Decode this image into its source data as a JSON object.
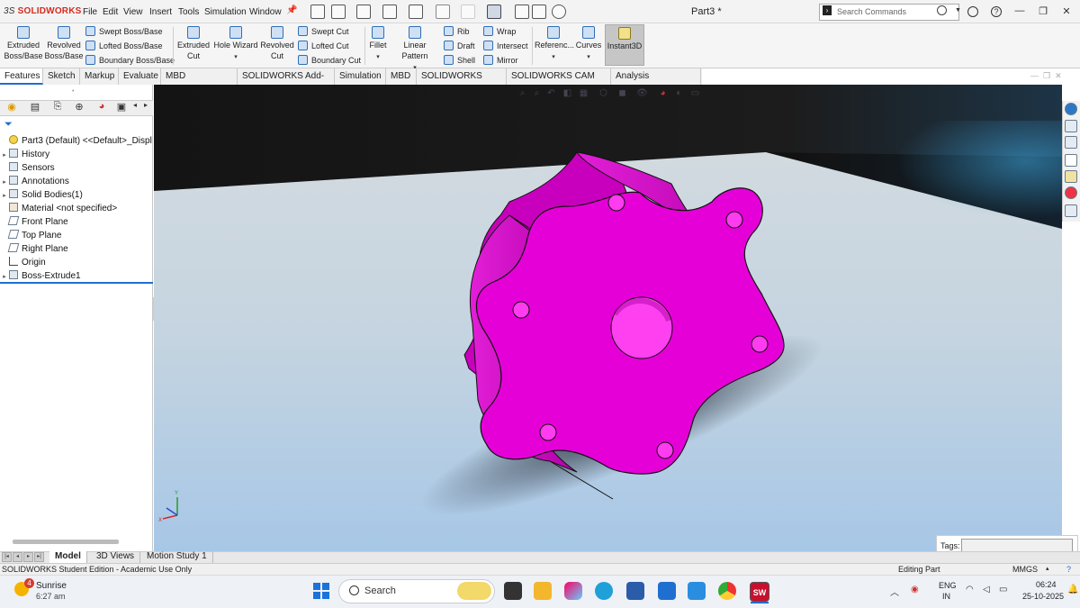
{
  "app": {
    "brand": "SOLIDWORKS",
    "brand_prefix": "3S",
    "document_title": "Part3 *",
    "brand_color": "#d52b1e"
  },
  "menu": [
    "File",
    "Edit",
    "View",
    "Insert",
    "Tools",
    "Simulation",
    "Window"
  ],
  "search": {
    "placeholder": "Search Commands"
  },
  "ribbon": {
    "extruded_boss": [
      "Extruded",
      "Boss/Base"
    ],
    "revolved_boss": [
      "Revolved",
      "Boss/Base"
    ],
    "swept_boss": "Swept Boss/Base",
    "lofted_boss": "Lofted Boss/Base",
    "boundary_boss": "Boundary Boss/Base",
    "extruded_cut": [
      "Extruded",
      "Cut"
    ],
    "hole_wizard": "Hole Wizard",
    "revolved_cut": [
      "Revolved",
      "Cut"
    ],
    "swept_cut": "Swept Cut",
    "lofted_cut": "Lofted Cut",
    "boundary_cut": "Boundary Cut",
    "fillet": "Fillet",
    "linear_pattern": "Linear Pattern",
    "rib": "Rib",
    "draft": "Draft",
    "shell": "Shell",
    "wrap": "Wrap",
    "intersect": "Intersect",
    "mirror": "Mirror",
    "reference": "Referenc...",
    "curves": "Curves",
    "instant3d": "Instant3D"
  },
  "command_tabs": [
    "Features",
    "Sketch",
    "Markup",
    "Evaluate",
    "MBD Dimensions",
    "SOLIDWORKS Add-Ins",
    "Simulation",
    "MBD",
    "SOLIDWORKS CAM",
    "SOLIDWORKS CAM TBM",
    "Analysis Preparation"
  ],
  "feature_tree": [
    {
      "label": "Part3 (Default) <<Default>_Displ",
      "icon": "part-icon"
    },
    {
      "label": "History",
      "icon": "history-icon"
    },
    {
      "label": "Sensors",
      "icon": "sensor-icon"
    },
    {
      "label": "Annotations",
      "icon": "annotation-icon"
    },
    {
      "label": "Solid Bodies(1)",
      "icon": "solid-bodies-icon"
    },
    {
      "label": "Material <not specified>",
      "icon": "material-icon"
    },
    {
      "label": "Front Plane",
      "icon": "plane-icon"
    },
    {
      "label": "Top Plane",
      "icon": "plane-icon"
    },
    {
      "label": "Right Plane",
      "icon": "plane-icon"
    },
    {
      "label": "Origin",
      "icon": "origin-icon"
    },
    {
      "label": "Boss-Extrude1",
      "icon": "boss-extrude-icon"
    }
  ],
  "model": {
    "color": "#e600d8"
  },
  "tags": {
    "label": "Tags:"
  },
  "bottom_tabs": [
    "Model",
    "3D Views",
    "Motion Study 1"
  ],
  "status": {
    "left": "SOLIDWORKS Student Edition - Academic Use Only",
    "mode": "Editing Part",
    "units": "MMGS"
  },
  "taskbar": {
    "weather_title": "Sunrise",
    "weather_time": "6:27 am",
    "weather_badge": "4",
    "search_text": "Search",
    "lang1": "ENG",
    "lang2": "IN",
    "time": "06:24",
    "date": "25-10-2025"
  }
}
